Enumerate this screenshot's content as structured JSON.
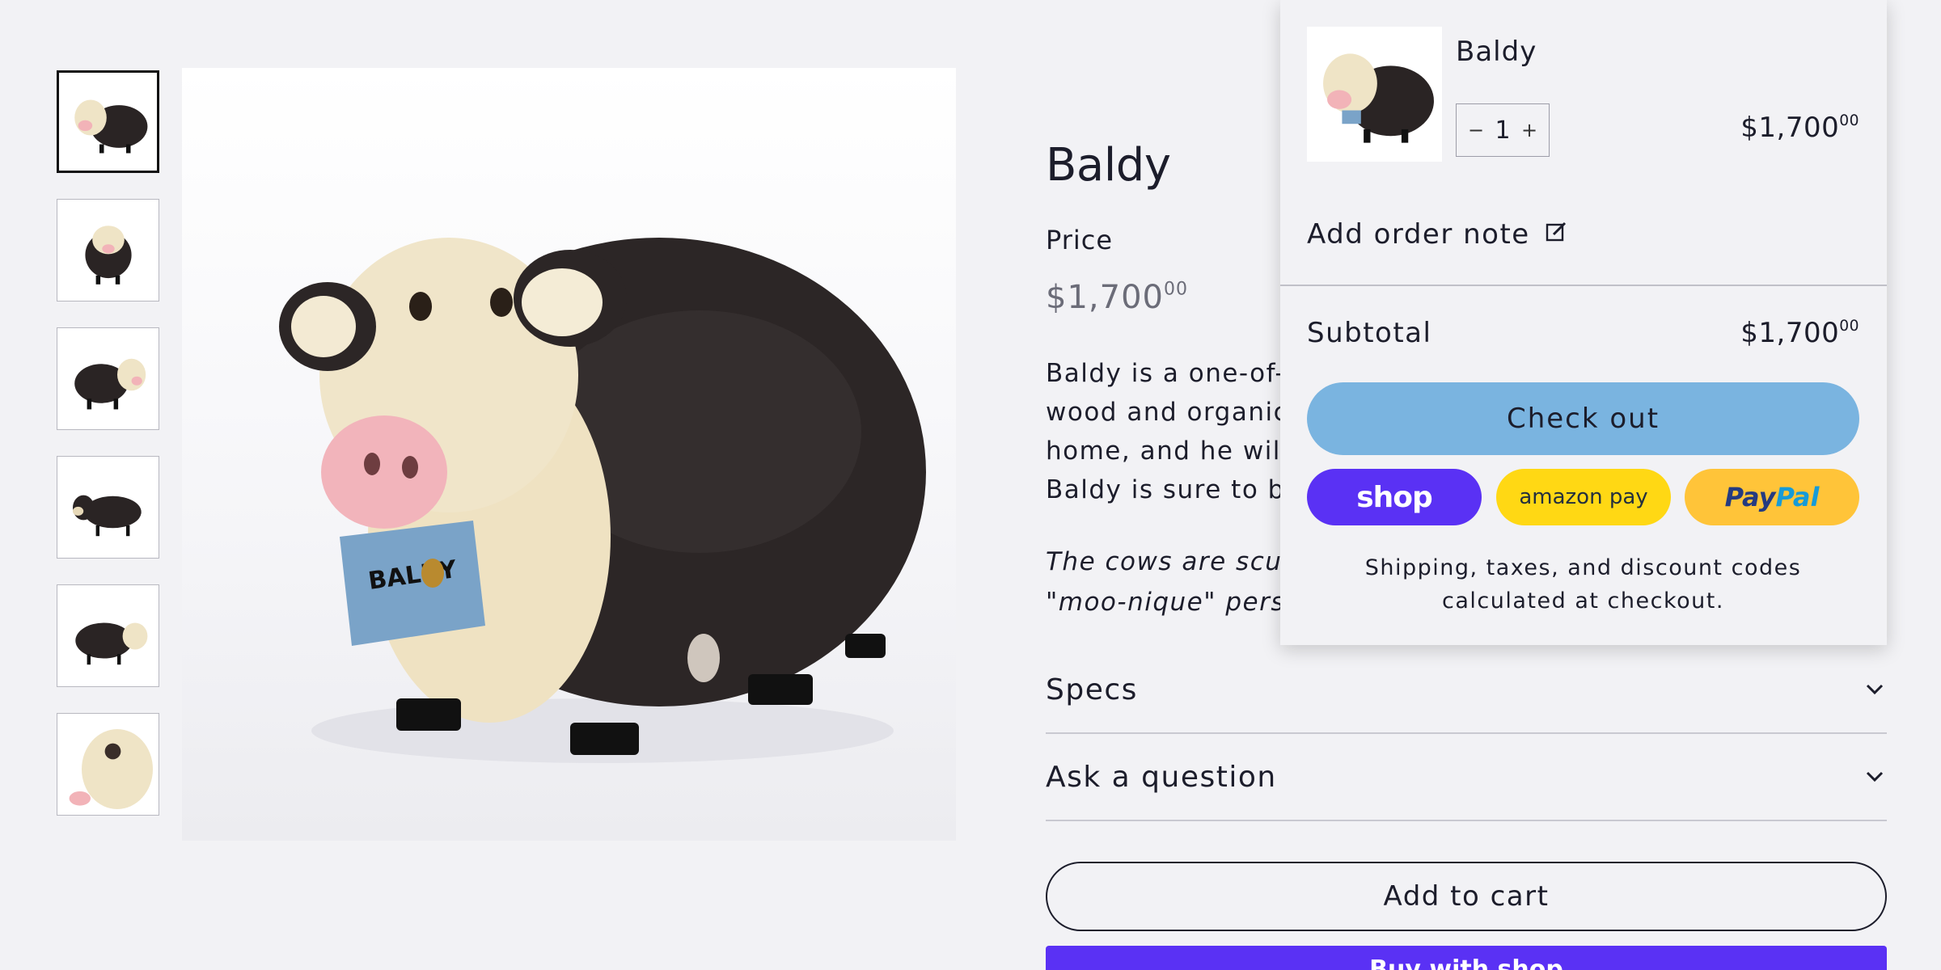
{
  "product": {
    "title": "Baldy",
    "price_label": "Price",
    "price_main": "$1,700",
    "price_cents": "00",
    "description": "Baldy is a one-of-a",
    "description_lines": [
      "Baldy is a one-of-a",
      "wood and organic l",
      "home, and he will b",
      "Baldy is sure to be"
    ],
    "description_italic_lines": [
      "The cows are sculp",
      "\"moo-nique\" person"
    ],
    "accordions": [
      {
        "label": "Specs"
      },
      {
        "label": "Ask a question"
      }
    ],
    "add_to_cart_label": "Add to cart",
    "buy_with_label": "Buy with shop"
  },
  "cart": {
    "item_name": "Baldy",
    "quantity": "1",
    "qty_minus": "−",
    "qty_plus": "+",
    "item_price_main": "$1,700",
    "item_price_cents": "00",
    "add_order_note_label": "Add order note",
    "subtotal_label": "Subtotal",
    "subtotal_main": "$1,700",
    "subtotal_cents": "00",
    "checkout_label": "Check out",
    "shop_pay_label": "shop",
    "amazon_pay_label": "amazon pay",
    "paypal_label_1": "Pay",
    "paypal_label_2": "Pal",
    "shipping_note": "Shipping, taxes, and discount codes calculated at checkout."
  },
  "colors": {
    "background": "#f2f2f5",
    "checkout_button": "#7ab4e0",
    "shop_pay": "#5a31f4",
    "amazon_pay": "#ffd814",
    "paypal": "#ffc439"
  },
  "icons": {
    "chevron": "chevron-down-icon",
    "note": "edit-note-icon"
  }
}
